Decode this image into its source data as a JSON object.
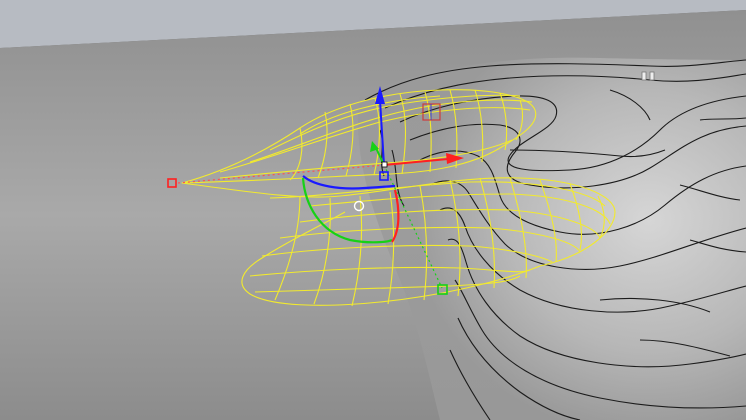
{
  "viewport": {
    "background_sky": "#b7bbc2",
    "background_ground_light": "#c7c7c7",
    "background_ground_dark": "#858585",
    "terrain_line_color": "#1b1b1b",
    "cage_color": "#f2ea2e",
    "gizmo": {
      "x_axis_color": "#ff2020",
      "y_axis_color": "#16d116",
      "z_axis_color": "#1a1aff",
      "dotted_axis_color": "#ff5050",
      "control_point_color": "#ff2020"
    }
  }
}
